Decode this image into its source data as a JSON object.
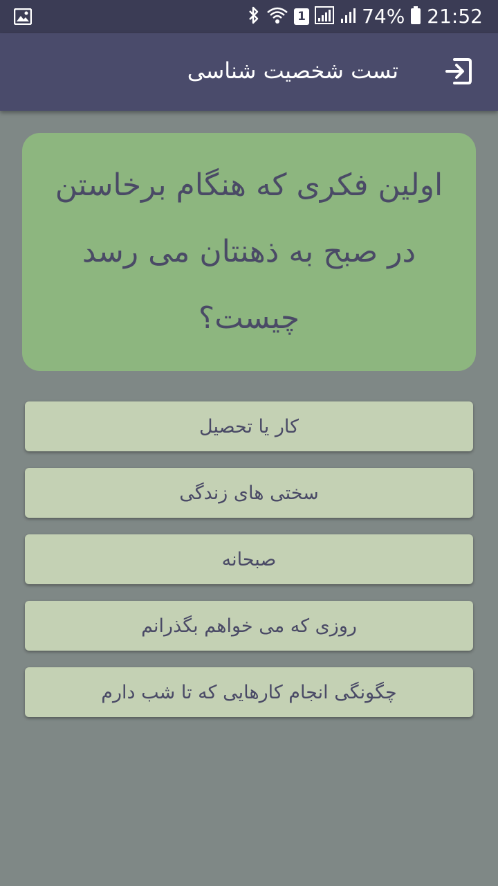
{
  "status_bar": {
    "sim_slot": "1",
    "battery_percent": "74%",
    "time": "21:52",
    "icons": [
      "image-icon",
      "bluetooth-icon",
      "wifi-icon",
      "sim-icon",
      "signal-icon",
      "signal-icon",
      "battery-icon"
    ]
  },
  "app_bar": {
    "title": "تست شخصیت شناسی",
    "exit_icon": "exit-icon"
  },
  "question": {
    "text": "اولین فکری که هنگام برخاستن در صبح به ذهنتان می رسد چیست؟"
  },
  "answers": [
    {
      "label": "کار یا تحصیل"
    },
    {
      "label": "سختی های زندگی"
    },
    {
      "label": "صبحانه"
    },
    {
      "label": "روزی که می خواهم بگذرانم"
    },
    {
      "label": "چگونگی انجام کارهایی که تا شب دارم"
    }
  ],
  "colors": {
    "status_bar": "#3b3c55",
    "app_bar": "#4a4b6b",
    "background": "#7f8886",
    "question_card": "#8db67f",
    "answer_button": "#c4d1b4",
    "text": "#4a4a66"
  }
}
